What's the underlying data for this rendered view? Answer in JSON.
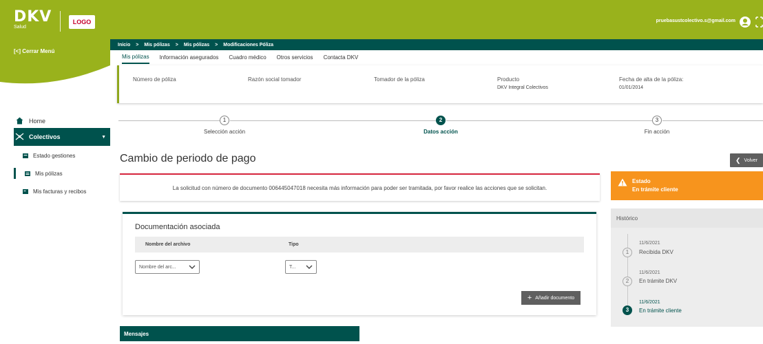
{
  "header": {
    "brand": "DKV",
    "brand_sub": "Salud",
    "logo_text": "LOGO",
    "user_email": "pruebasustcolectivo.s@gmail.com",
    "bg_color": "#99b21c",
    "accent_color": "#00524d"
  },
  "sidebar": {
    "close_menu": "[<] Cerrar Menú",
    "home": "Home",
    "colectivos": "Colectivos",
    "sub_items": [
      "Estado gestiones",
      "Mis pólizas",
      "Mis facturas y recibos"
    ]
  },
  "breadcrumb": [
    "Inicio",
    ">",
    "Mis pólizas",
    ">",
    "Mis pólizas",
    ">",
    "Modificaciones Póliza"
  ],
  "tabs": [
    "Mis pólizas",
    "Información asegurados",
    "Cuadro médico",
    "Otros servicios",
    "Contacta DKV"
  ],
  "policy": {
    "numero_label": "Número de póliza",
    "razon_label": "Razón social tomador",
    "tomador_label": "Tomador de la póliza",
    "producto_label": "Producto",
    "producto_value": "DKV Integral Colectivos",
    "fecha_label": "Fecha de alta de la póliza:",
    "fecha_value": "01/01/2014"
  },
  "stepper": {
    "steps": [
      {
        "num": "1",
        "label": "Selección acción"
      },
      {
        "num": "2",
        "label": "Datos acción"
      },
      {
        "num": "3",
        "label": "Fin acción"
      }
    ],
    "current": 2
  },
  "page_title": "Cambio de periodo de pago",
  "back_button": "Volver",
  "alert_text": "La solicitud con número de documento 006445047018 necesita más información para poder ser tramitada, por favor realice las acciones que se solicitan.",
  "estado": {
    "label": "Estado",
    "value": "En trámite cliente",
    "color": "#f7941d"
  },
  "historico": {
    "title": "Histórico",
    "entries": [
      {
        "num": "1",
        "date": "11/6/2021",
        "state": "Recibida DKV"
      },
      {
        "num": "2",
        "date": "11/6/2021",
        "state": "En trámite DKV"
      },
      {
        "num": "3",
        "date": "11/6/2021",
        "state": "En trámite cliente"
      }
    ]
  },
  "documentation": {
    "title": "Documentación asociada",
    "col_file": "Nombre del archivo",
    "col_type": "Tipo",
    "file_placeholder": "Nombre del arc...",
    "type_placeholder": "T...",
    "add_button": "Añadir documento"
  },
  "mensajes": "Mensajes"
}
